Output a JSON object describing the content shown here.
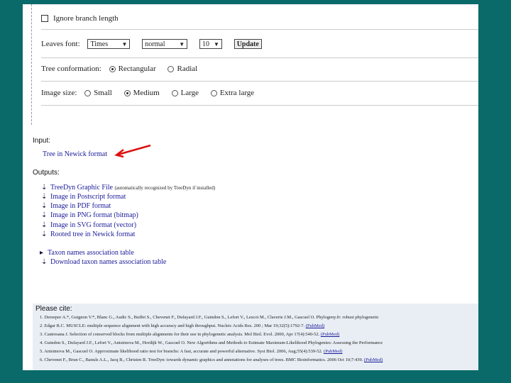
{
  "options": {
    "ignore_branch_length_label": "Ignore branch length",
    "leaves_font": {
      "label": "Leaves font:",
      "font_value": "Times",
      "style_value": "normal",
      "size_value": "10",
      "update_label": "Update"
    },
    "tree_conformation": {
      "label": "Tree conformation:",
      "options": [
        "Rectangular",
        "Radial"
      ],
      "selected": "Rectangular"
    },
    "image_size": {
      "label": "Image size:",
      "options": [
        "Small",
        "Medium",
        "Large",
        "Extra large"
      ],
      "selected": "Medium"
    }
  },
  "input": {
    "heading": "Input:",
    "link": "Tree in Newick format"
  },
  "outputs": {
    "heading": "Outputs:",
    "items": [
      {
        "label": "TreeDyn Graphic File",
        "note": "(automatically recognized by TreeDyn if installed)"
      },
      {
        "label": "Image in Postscript format"
      },
      {
        "label": "Image in PDF format"
      },
      {
        "label": "Image in PNG format (bitmap)"
      },
      {
        "label": "Image in SVG format (vector)"
      },
      {
        "label": "Rooted tree in Newick format"
      }
    ],
    "taxon_items": [
      {
        "label": "Taxon names association table"
      },
      {
        "label": "Download taxon names association table"
      }
    ]
  },
  "cite": {
    "heading": "Please cite:",
    "lines": [
      {
        "text": "1.  Dereeper A.*, Guignon V.*, Blanc G., Audic S., Buffet S., Chevenet F., Dufayard J.F., Guindon S., Lefort V., Lescot M., Claverie J.M., Gascuel O. Phylogeny.fr: robust phylogenetic",
        "pub": ""
      },
      {
        "text": "2.  Edgar R.C. MUSCLE: multiple sequence alignment with high accuracy and high throughput. Nucleic Acids Res. 200 ; Mar 19;32(5):1792-7. ",
        "pub": "(PubMed)"
      },
      {
        "text": "3.  Castresana J. Selection of conserved blocks from multiple alignments for their use in phylogenetic analysis. Mol Biol. Evol. 2000, Apr 17(4):540-52. ",
        "pub": "(PubMed)"
      },
      {
        "text": "4.  Guindon S., Dufayard J.F., Lefort V., Anisimova M., Hordijk W., Gascuel O. New Algorithms and Methods to Estimate Maximum-Likelihood Phylogenies: Assessing the Performance",
        "pub": ""
      },
      {
        "text": "5.  Anisimova M., Gascuel O. Approximate likelihood ratio test for branchs: A fast, accurate and powerful alternative. Syst Biol. 2006, Aug;55(4):539-52. ",
        "pub": "(PubMed)"
      },
      {
        "text": "6.  Chevenet F., Brun C., Banuls A.L., Jacq B., Christen R. TreeDyn: towards dynamic graphics and annotations for analyses of trees. BMC Bioinformatics. 2006 Oct 10;7:439. ",
        "pub": "(PubMed)"
      }
    ]
  },
  "colors": {
    "background": "#0a6a6a",
    "link": "#1a1a99",
    "arrow": "#dd1111",
    "cite_bg": "#e8eef4"
  }
}
